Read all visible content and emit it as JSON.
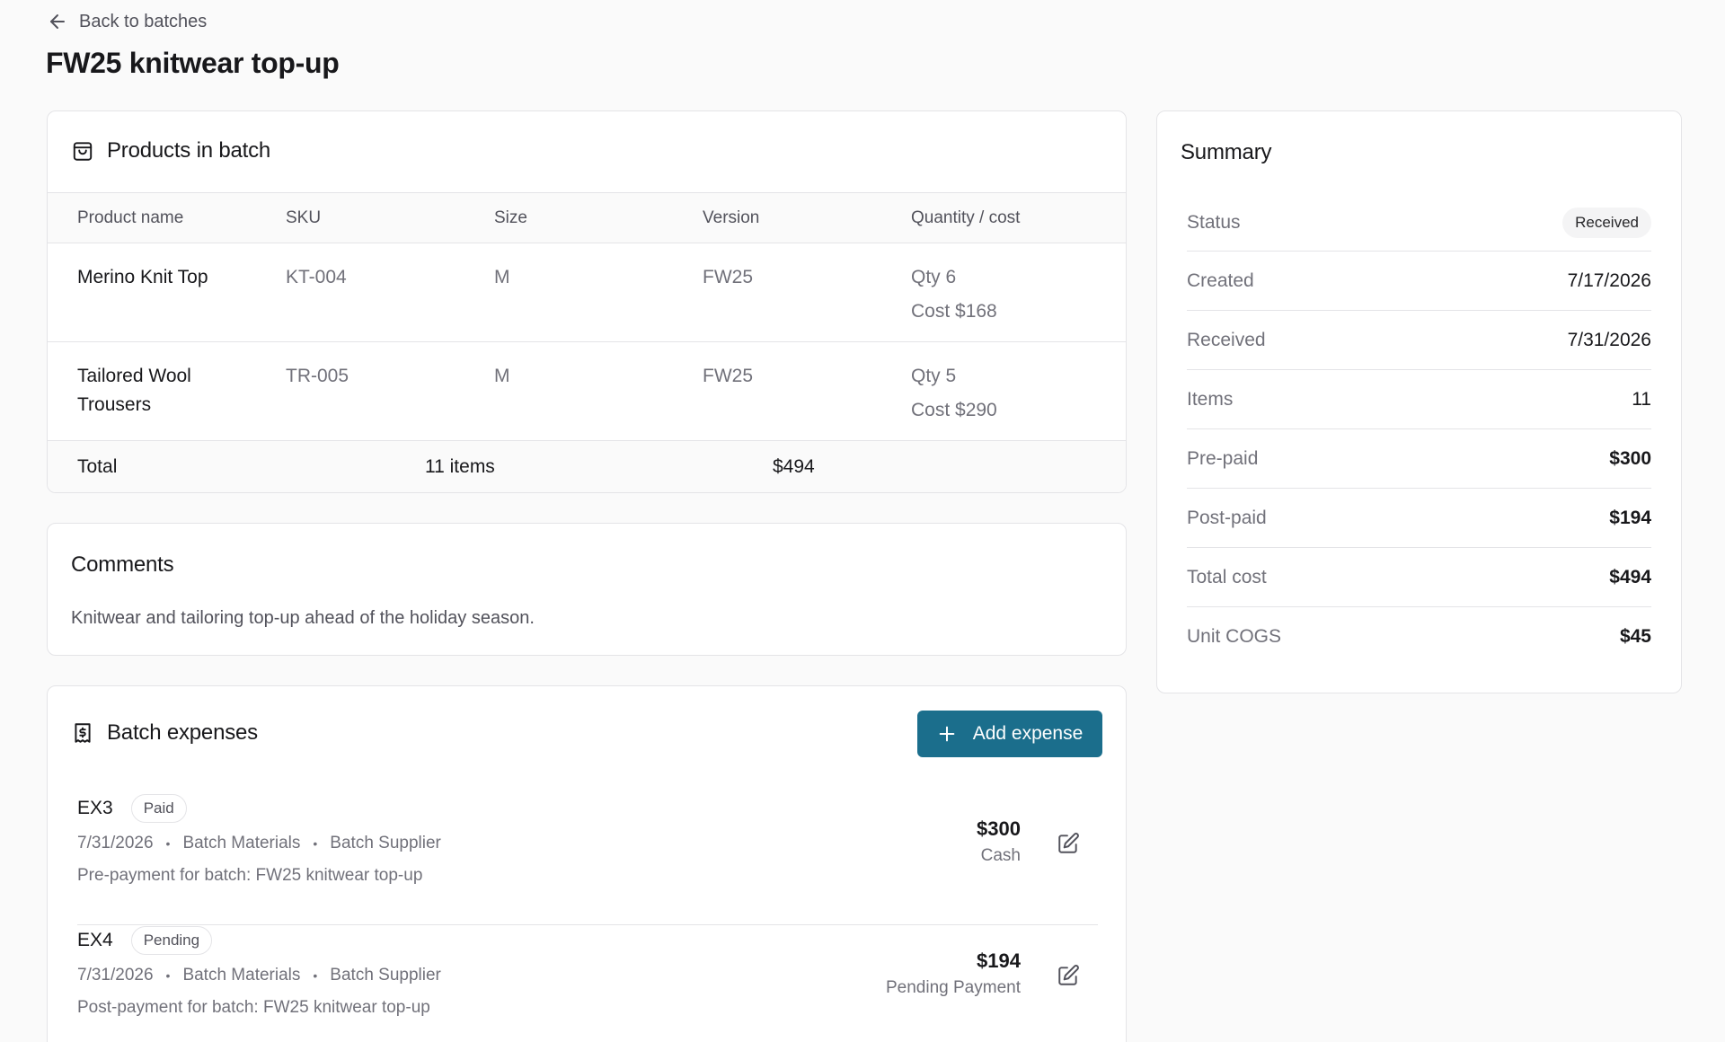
{
  "nav": {
    "back_label": "Back to batches"
  },
  "page": {
    "title": "FW25 knitwear top-up"
  },
  "products": {
    "title": "Products in batch",
    "columns": [
      "Product name",
      "SKU",
      "Size",
      "Version",
      "Quantity / cost"
    ],
    "rows": [
      {
        "name": "Merino Knit Top",
        "sku": "KT-004",
        "size": "M",
        "version": "FW25",
        "qty": "Qty 6",
        "cost": "Cost $168"
      },
      {
        "name": "Tailored Wool Trousers",
        "sku": "TR-005",
        "size": "M",
        "version": "FW25",
        "qty": "Qty 5",
        "cost": "Cost $290"
      }
    ],
    "total": {
      "label": "Total",
      "items": "11 items",
      "amount": "$494"
    }
  },
  "comments": {
    "title": "Comments",
    "text": "Knitwear and tailoring top-up ahead of the holiday season."
  },
  "expenses": {
    "title": "Batch expenses",
    "add_label": "Add expense",
    "items": [
      {
        "id": "EX3",
        "status": "Paid",
        "date": "7/31/2026",
        "category": "Batch Materials",
        "supplier": "Batch Supplier",
        "description": "Pre-payment for batch: FW25 knitwear top-up",
        "amount": "$300",
        "method": "Cash"
      },
      {
        "id": "EX4",
        "status": "Pending",
        "date": "7/31/2026",
        "category": "Batch Materials",
        "supplier": "Batch Supplier",
        "description": "Post-payment for batch: FW25 knitwear top-up",
        "amount": "$194",
        "method": "Pending Payment"
      }
    ]
  },
  "summary": {
    "title": "Summary",
    "status_label": "Status",
    "status_value": "Received",
    "rows": [
      {
        "label": "Created",
        "value": "7/17/2026"
      },
      {
        "label": "Received",
        "value": "7/31/2026"
      },
      {
        "label": "Items",
        "value": "11"
      },
      {
        "label": "Pre-paid",
        "value": "$300"
      },
      {
        "label": "Post-paid",
        "value": "$194"
      },
      {
        "label": "Total cost",
        "value": "$494"
      },
      {
        "label": "Unit COGS",
        "value": "$45"
      }
    ]
  },
  "colors": {
    "accent": "#1b6e8c",
    "border": "#e4e4e7",
    "muted_text": "#71717a"
  }
}
